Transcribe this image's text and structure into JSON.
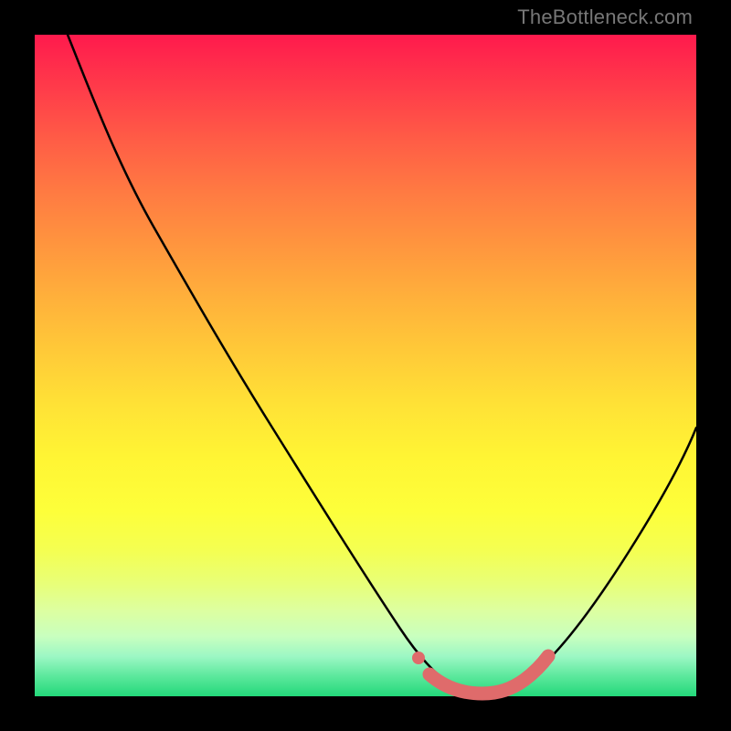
{
  "watermark": "TheBottleneck.com",
  "chart_data": {
    "type": "line",
    "title": "",
    "xlabel": "",
    "ylabel": "",
    "xlim": [
      0,
      100
    ],
    "ylim": [
      0,
      100
    ],
    "series": [
      {
        "name": "bottleneck-curve",
        "x": [
          5,
          10,
          15,
          20,
          25,
          30,
          35,
          40,
          45,
          50,
          55,
          58,
          60,
          63,
          67,
          70,
          73,
          77,
          82,
          88,
          94,
          100
        ],
        "y": [
          100,
          90,
          80,
          70,
          60,
          50,
          41,
          32,
          24,
          16,
          9,
          5,
          3,
          1.5,
          0.8,
          0.8,
          1.5,
          4,
          10,
          20,
          32,
          45
        ],
        "color": "#000000"
      },
      {
        "name": "optimal-range-highlight",
        "x": [
          57,
          60,
          63,
          66,
          69,
          71,
          73
        ],
        "y": [
          5,
          2.5,
          1.2,
          0.8,
          1.0,
          2.0,
          4.0
        ],
        "color": "#e06666"
      }
    ],
    "colors": {
      "background_top": "#ff1a4d",
      "background_mid": "#ffea36",
      "background_bottom": "#23d87a",
      "curve": "#000000",
      "highlight": "#e06666",
      "frame": "#000000"
    }
  }
}
